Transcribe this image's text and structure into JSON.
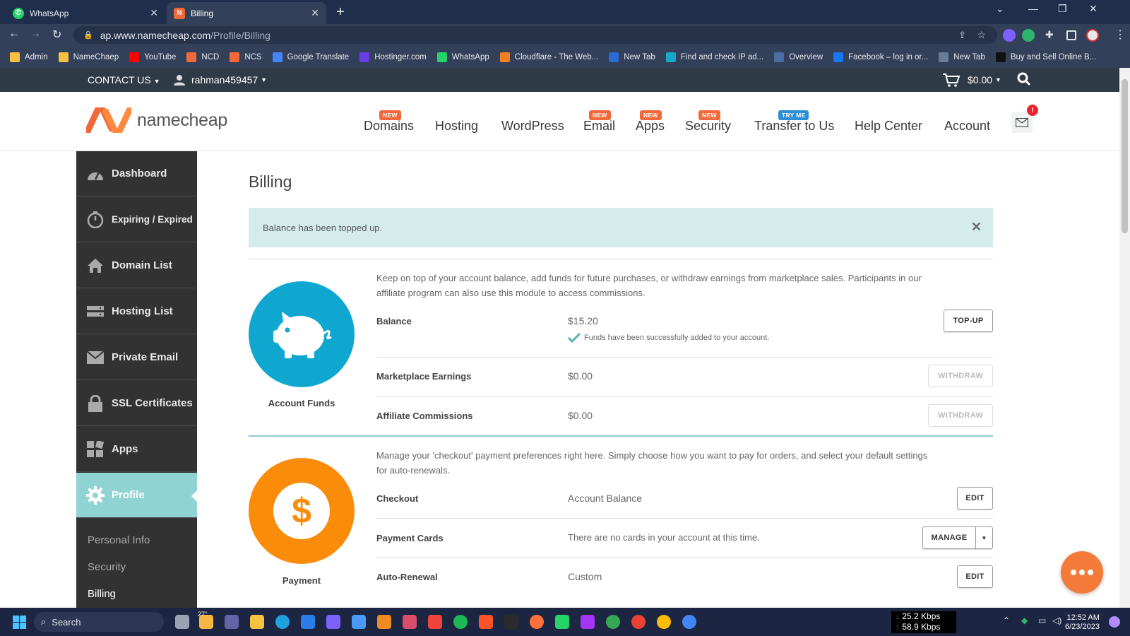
{
  "browser": {
    "tabs": [
      {
        "title": "WhatsApp",
        "active": false
      },
      {
        "title": "Billing",
        "active": true
      }
    ],
    "url_host": "ap.www.namecheap.com",
    "url_path": "/Profile/Billing",
    "bookmarks": [
      {
        "label": "Admin",
        "icon": "folder-icon",
        "color": "#f5c242"
      },
      {
        "label": "NameChaep",
        "icon": "folder-icon",
        "color": "#f5c242"
      },
      {
        "label": "YouTube",
        "icon": "youtube-icon",
        "color": "#ff0000"
      },
      {
        "label": "NCD",
        "icon": "namecheap-icon",
        "color": "#f1693a"
      },
      {
        "label": "NCS",
        "icon": "namecheap-icon",
        "color": "#f1693a"
      },
      {
        "label": "Google Translate",
        "icon": "translate-icon",
        "color": "#4285f4"
      },
      {
        "label": "Hostinger.com",
        "icon": "hostinger-icon",
        "color": "#673de6"
      },
      {
        "label": "WhatsApp",
        "icon": "whatsapp-icon",
        "color": "#25d366"
      },
      {
        "label": "Cloudflare - The Web...",
        "icon": "cloudflare-icon",
        "color": "#f38020"
      },
      {
        "label": "New Tab",
        "icon": "newtab-icon",
        "color": "#2c6bd6"
      },
      {
        "label": "Find and check IP ad...",
        "icon": "w-icon",
        "color": "#1aa6c8"
      },
      {
        "label": "Overview",
        "icon": "overview-icon",
        "color": "#4a6fa5"
      },
      {
        "label": "Facebook – log in or...",
        "icon": "facebook-icon",
        "color": "#1877f2"
      },
      {
        "label": "New Tab",
        "icon": "monitor-icon",
        "color": "#6a7b95"
      },
      {
        "label": "Buy and Sell Online B...",
        "icon": "e-icon",
        "color": "#111111"
      }
    ]
  },
  "site": {
    "topbar": {
      "contact": "CONTACT US",
      "username": "rahman459457",
      "cart_total": "$0.00"
    },
    "logo_text": "namecheap",
    "nav": [
      {
        "label": "Domains",
        "badge": "NEW"
      },
      {
        "label": "Hosting",
        "badge": ""
      },
      {
        "label": "WordPress",
        "badge": ""
      },
      {
        "label": "Email",
        "badge": "NEW"
      },
      {
        "label": "Apps",
        "badge": "NEW"
      },
      {
        "label": "Security",
        "badge": "NEW"
      },
      {
        "label": "Transfer to Us",
        "badge": "TRY ME"
      },
      {
        "label": "Help Center",
        "badge": ""
      },
      {
        "label": "Account",
        "badge": ""
      }
    ],
    "mail_count": "!"
  },
  "sidebar": {
    "items": [
      {
        "label": "Dashboard",
        "icon": "gauge-icon"
      },
      {
        "label": "Expiring / Expired",
        "icon": "timer-icon"
      },
      {
        "label": "Domain List",
        "icon": "home-icon"
      },
      {
        "label": "Hosting List",
        "icon": "server-icon"
      },
      {
        "label": "Private Email",
        "icon": "envelope-icon"
      },
      {
        "label": "SSL Certificates",
        "icon": "lock-icon"
      },
      {
        "label": "Apps",
        "icon": "apps-icon"
      },
      {
        "label": "Profile",
        "icon": "gear-icon",
        "active": true
      }
    ],
    "subitems": [
      "Personal Info",
      "Security",
      "Billing"
    ]
  },
  "billing": {
    "title": "Billing",
    "alert": "Balance has been topped up.",
    "funds": {
      "label": "Account Funds",
      "description": "Keep on top of your account balance, add funds for future purchases, or withdraw earnings from marketplace sales. Participants in our affiliate program can also use this module to access commissions.",
      "rows": [
        {
          "label": "Balance",
          "value": "$15.20",
          "note": "Funds have been successfully added to your account.",
          "button": "TOP-UP"
        },
        {
          "label": "Marketplace Earnings",
          "value": "$0.00",
          "button": "WITHDRAW"
        },
        {
          "label": "Affiliate Commissions",
          "value": "$0.00",
          "button": "WITHDRAW"
        }
      ]
    },
    "payment": {
      "label": "Payment",
      "description": "Manage your 'checkout' payment preferences right here. Simply choose how you want to pay for orders, and select your default settings for auto-renewals.",
      "rows": [
        {
          "label": "Checkout",
          "value": "Account Balance",
          "button": "EDIT"
        },
        {
          "label": "Payment Cards",
          "value": "There are no cards in your account at this time.",
          "button": "MANAGE"
        },
        {
          "label": "Auto-Renewal",
          "value": "Custom",
          "button": "EDIT"
        }
      ]
    }
  },
  "taskbar": {
    "search": "Search",
    "weather": "27°",
    "download_speed": "25.2 Kbps",
    "upload_speed": "58.9 Kbps",
    "time": "12:52 AM",
    "date": "6/23/2023"
  },
  "colors": {
    "accent_teal": "#8fd4d2",
    "brand_orange": "#f1693a",
    "funds_blue": "#0fa7cf",
    "payment_orange": "#fa8c0a",
    "sidebar_dark": "#323232"
  }
}
